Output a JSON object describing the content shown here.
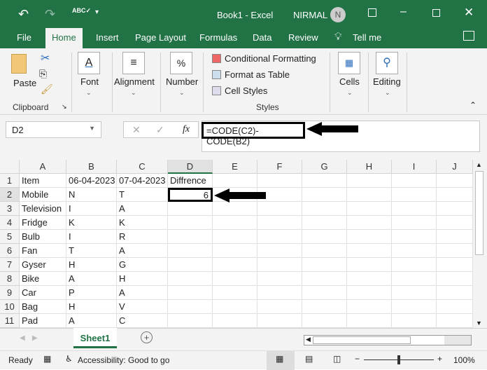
{
  "title": {
    "doc": "Book1  -  Excel",
    "user": "NIRMAL",
    "avatar": "N"
  },
  "colors": {
    "brand": "#217346"
  },
  "tabs": [
    "File",
    "Home",
    "Insert",
    "Page Layout",
    "Formulas",
    "Data",
    "Review",
    "Tell me"
  ],
  "ribbon": {
    "paste": "Paste",
    "clipboard": "Clipboard",
    "font": "Font",
    "alignment": "Alignment",
    "number": "Number",
    "cond": "Conditional Formatting",
    "fat": "Format as Table",
    "cellstyles": "Cell Styles",
    "styles": "Styles",
    "cells": "Cells",
    "editing": "Editing"
  },
  "formula": {
    "namebox": "D2",
    "fx": "fx",
    "value": "=CODE(C2)-CODE(B2)"
  },
  "columns": [
    "A",
    "B",
    "C",
    "D",
    "E",
    "F",
    "G",
    "H",
    "I",
    "J"
  ],
  "rows": [
    [
      "Item",
      "06-04-2023",
      "07-04-2023",
      "Diffrence"
    ],
    [
      "Mobile",
      "N",
      "T",
      "6"
    ],
    [
      "Television",
      "I",
      "A",
      ""
    ],
    [
      "Fridge",
      "K",
      "K",
      ""
    ],
    [
      "Bulb",
      "I",
      "R",
      ""
    ],
    [
      "Fan",
      "T",
      "A",
      ""
    ],
    [
      "Gyser",
      "H",
      "G",
      ""
    ],
    [
      "Bike",
      "A",
      "H",
      ""
    ],
    [
      "Car",
      "P",
      "A",
      ""
    ],
    [
      "Bag",
      "H",
      "V",
      ""
    ],
    [
      "Pad",
      "A",
      "C",
      ""
    ]
  ],
  "sheet": {
    "tab": "Sheet1"
  },
  "status": {
    "ready": "Ready",
    "accessibility": "Accessibility: Good to go",
    "zoom": "100%"
  }
}
